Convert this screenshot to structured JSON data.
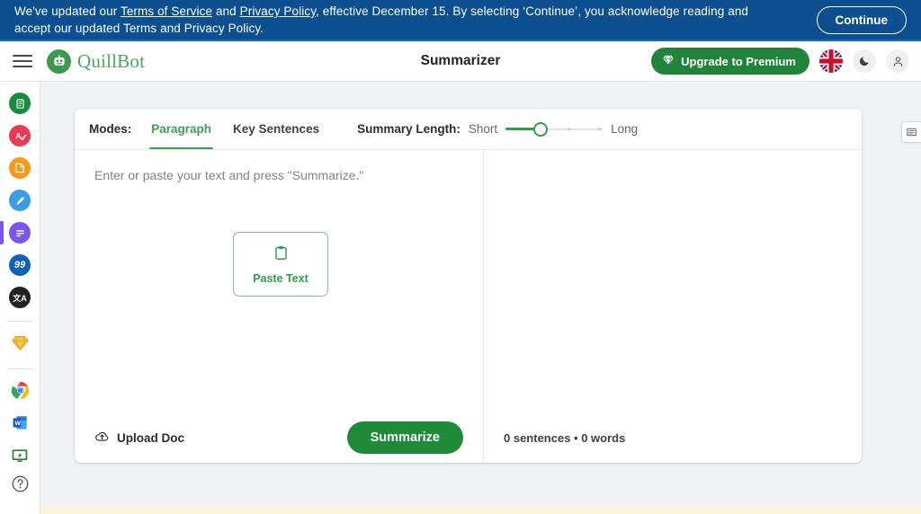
{
  "banner": {
    "text_part1": "We've updated our ",
    "link1": "Terms of Service",
    "text_part2": " and ",
    "link2": "Privacy Policy",
    "text_part3": ", effective December 15. By selecting ‘Continue’, you acknowledge reading and accept our updated Terms and Privacy Policy.",
    "button": "Continue",
    "bg_color": "#0b4f91"
  },
  "appbar": {
    "menu_label": "Menu",
    "brand": "QuillBot",
    "title": "Summarizer",
    "premium_button": "Upgrade to Premium",
    "premium_color": "#20843b",
    "language": "English (UK)",
    "theme_toggle": "Dark mode",
    "account": "Account"
  },
  "sidebar": {
    "tools": [
      {
        "name": "paraphraser",
        "label": "Paraphraser",
        "color": "#1a8a3f",
        "glyph": "⎘"
      },
      {
        "name": "grammar-checker",
        "label": "Grammar Checker",
        "color": "#ea3b52",
        "glyph": "A"
      },
      {
        "name": "plagiarism-checker",
        "label": "Plagiarism Checker",
        "color": "#f59a1f",
        "glyph": "◔"
      },
      {
        "name": "co-writer",
        "label": "Co-Writer",
        "color": "#3b9de8",
        "glyph": "✎"
      },
      {
        "name": "summarizer",
        "label": "Summarizer",
        "color": "#7b55ec",
        "glyph": "≡",
        "active": true
      },
      {
        "name": "citation-generator",
        "label": "Citation Generator",
        "color": "#1160ba",
        "glyph": "99"
      },
      {
        "name": "translator",
        "label": "Translator",
        "color": "#222222",
        "glyph": "文A"
      }
    ],
    "premium": {
      "name": "premium",
      "label": "Premium",
      "color": "#e8b42a"
    },
    "extensions": [
      {
        "name": "chrome-extension",
        "label": "Chrome Extension"
      },
      {
        "name": "word-addin",
        "label": "Word Add-in"
      },
      {
        "name": "desktop-app",
        "label": "Desktop App"
      }
    ],
    "help": {
      "name": "help",
      "label": "Help"
    }
  },
  "toolbar": {
    "modes_label": "Modes:",
    "modes": [
      {
        "label": "Paragraph",
        "active": true
      },
      {
        "label": "Key Sentences",
        "active": false
      }
    ],
    "summary_length_label": "Summary Length:",
    "length_min": "Short",
    "length_max": "Long",
    "slider_value": 1,
    "slider_steps": 4
  },
  "editor": {
    "placeholder": "Enter or paste your text and press \"Summarize.\"",
    "paste_button": "Paste Text",
    "upload_button": "Upload Doc",
    "summarize_button": "Summarize"
  },
  "output": {
    "stats": "0 sentences • 0 words",
    "panel_toggle": "Toggle output panel"
  }
}
